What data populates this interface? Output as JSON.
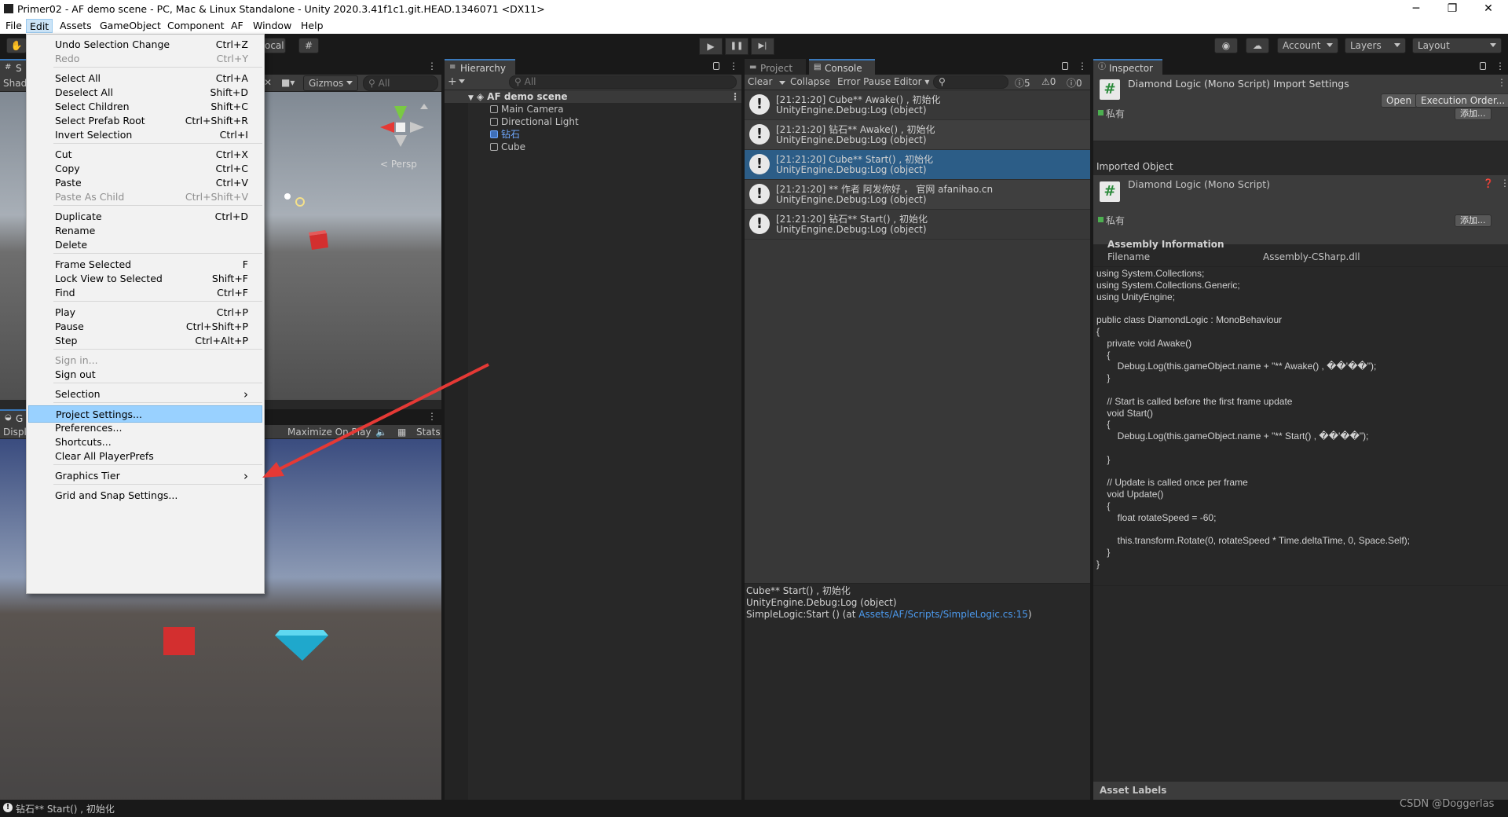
{
  "window": {
    "title": "Primer02 - AF demo scene - PC, Mac & Linux Standalone - Unity 2020.3.41f1c1.git.HEAD.1346071 <DX11>",
    "minimize_glyph": "─",
    "maximize_glyph": "❐",
    "close_glyph": "✕"
  },
  "menubar": [
    "File",
    "Edit",
    "Assets",
    "GameObject",
    "Component",
    "AF",
    "Window",
    "Help"
  ],
  "toolbar": {
    "pivot_partial": "ocal",
    "play_glyph": "▶",
    "pause_glyph": "❚❚",
    "step_glyph": "▶|",
    "account_label": "Account",
    "layers_label": "Layers",
    "layout_label": "Layout"
  },
  "scene_panel": {
    "tab_partial": "S",
    "shading_partial": "Shad",
    "gizmos_label": "Gizmos",
    "search_placeholder": "All",
    "persp_label": "< Persp"
  },
  "game_panel": {
    "tab_partial": "G",
    "display_partial": "Displ",
    "maximize_label": "Maximize On Play",
    "stats_label": "Stats"
  },
  "hierarchy": {
    "tab_label": "Hierarchy",
    "add_label": "+",
    "search_placeholder": "All",
    "scene_name": "AF demo scene",
    "items": [
      "Main Camera",
      "Directional Light",
      "钻石",
      "Cube"
    ]
  },
  "console": {
    "tab_project": "Project",
    "tab_console": "Console",
    "clear_label": "Clear",
    "collapse_label": "Collapse",
    "error_pause_label": "Error Pause",
    "editor_label": "Editor",
    "count_info": "5",
    "count_warn": "0",
    "count_error": "0",
    "entries": [
      {
        "line1": "[21:21:20] Cube** Awake() , 初始化",
        "line2": "UnityEngine.Debug:Log (object)"
      },
      {
        "line1": "[21:21:20] 钻石** Awake() , 初始化",
        "line2": "UnityEngine.Debug:Log (object)"
      },
      {
        "line1": "[21:21:20] Cube** Start() , 初始化",
        "line2": "UnityEngine.Debug:Log (object)"
      },
      {
        "line1": "[21:21:20] ** 作者 阿发你好 ， 官网 afanihao.cn",
        "line2": "UnityEngine.Debug:Log (object)"
      },
      {
        "line1": "[21:21:20] 钻石** Start() , 初始化",
        "line2": "UnityEngine.Debug:Log (object)"
      }
    ],
    "detail": {
      "line1": "Cube** Start() , 初始化",
      "line2": "UnityEngine.Debug:Log (object)",
      "line3_prefix": "SimpleLogic:Start () (at ",
      "line3_link": "Assets/AF/Scripts/SimpleLogic.cs:15",
      "line3_suffix": ")"
    }
  },
  "inspector": {
    "tab_label": "Inspector",
    "import_title": "Diamond Logic (Mono Script) Import Settings",
    "open_label": "Open",
    "execution_order_label": "Execution Order...",
    "private_label": "私有",
    "add_label": "添加...",
    "imported_object_label": "Imported Object",
    "script_title": "Diamond Logic (Mono Script)",
    "assembly_header": "Assembly Information",
    "filename_label": "Filename",
    "filename_value": "Assembly-CSharp.dll",
    "code": [
      "using System.Collections;",
      "using System.Collections.Generic;",
      "using UnityEngine;",
      "",
      "public class DiamondLogic : MonoBehaviour",
      "{",
      "    private void Awake()",
      "    {",
      "        Debug.Log(this.gameObject.name + \"** Awake() , ��'��\");",
      "    }",
      "",
      "    // Start is called before the first frame update",
      "    void Start()",
      "    {",
      "        Debug.Log(this.gameObject.name + \"** Start() , ��'��\");",
      "",
      "    }",
      "",
      "    // Update is called once per frame",
      "    void Update()",
      "    {",
      "        float rotateSpeed = -60;",
      "",
      "        this.transform.Rotate(0, rotateSpeed * Time.deltaTime, 0, Space.Self);",
      "    }",
      "}"
    ],
    "asset_labels": "Asset Labels"
  },
  "edit_menu": {
    "items": [
      {
        "label": "Undo Selection Change",
        "shortcut": "Ctrl+Z",
        "disabled": false
      },
      {
        "label": "Redo",
        "shortcut": "Ctrl+Y",
        "disabled": true
      },
      {
        "sep": true
      },
      {
        "label": "Select All",
        "shortcut": "Ctrl+A",
        "disabled": false
      },
      {
        "label": "Deselect All",
        "shortcut": "Shift+D",
        "disabled": false
      },
      {
        "label": "Select Children",
        "shortcut": "Shift+C",
        "disabled": false
      },
      {
        "label": "Select Prefab Root",
        "shortcut": "Ctrl+Shift+R",
        "disabled": false
      },
      {
        "label": "Invert Selection",
        "shortcut": "Ctrl+I",
        "disabled": false
      },
      {
        "sep": true
      },
      {
        "label": "Cut",
        "shortcut": "Ctrl+X",
        "disabled": false
      },
      {
        "label": "Copy",
        "shortcut": "Ctrl+C",
        "disabled": false
      },
      {
        "label": "Paste",
        "shortcut": "Ctrl+V",
        "disabled": false
      },
      {
        "label": "Paste As Child",
        "shortcut": "Ctrl+Shift+V",
        "disabled": true
      },
      {
        "sep": true
      },
      {
        "label": "Duplicate",
        "shortcut": "Ctrl+D",
        "disabled": false
      },
      {
        "label": "Rename",
        "shortcut": "",
        "disabled": false
      },
      {
        "label": "Delete",
        "shortcut": "",
        "disabled": false
      },
      {
        "sep": true
      },
      {
        "label": "Frame Selected",
        "shortcut": "F",
        "disabled": false
      },
      {
        "label": "Lock View to Selected",
        "shortcut": "Shift+F",
        "disabled": false
      },
      {
        "label": "Find",
        "shortcut": "Ctrl+F",
        "disabled": false
      },
      {
        "sep": true
      },
      {
        "label": "Play",
        "shortcut": "Ctrl+P",
        "disabled": false
      },
      {
        "label": "Pause",
        "shortcut": "Ctrl+Shift+P",
        "disabled": false
      },
      {
        "label": "Step",
        "shortcut": "Ctrl+Alt+P",
        "disabled": false
      },
      {
        "sep": true
      },
      {
        "label": "Sign in...",
        "shortcut": "",
        "disabled": true
      },
      {
        "label": "Sign out",
        "shortcut": "",
        "disabled": false
      },
      {
        "sep": true
      },
      {
        "label": "Selection",
        "shortcut": "›",
        "disabled": false
      },
      {
        "sep": true
      },
      {
        "label": "Project Settings...",
        "shortcut": "",
        "disabled": false,
        "highlighted": true
      },
      {
        "label": "Preferences...",
        "shortcut": "",
        "disabled": false
      },
      {
        "label": "Shortcuts...",
        "shortcut": "",
        "disabled": false
      },
      {
        "label": "Clear All PlayerPrefs",
        "shortcut": "",
        "disabled": false
      },
      {
        "sep": true
      },
      {
        "label": "Graphics Tier",
        "shortcut": "›",
        "disabled": false
      },
      {
        "sep": true
      },
      {
        "label": "Grid and Snap Settings...",
        "shortcut": "",
        "disabled": false
      }
    ]
  },
  "statusbar": {
    "message": "钻石** Start() , 初始化",
    "watermark": "CSDN @Doggerlas"
  },
  "colors": {
    "accent_blue": "#3a79bb",
    "selection_row": "#2c5d87",
    "menu_highlight": "#99d1ff",
    "arrow_red": "#e53935",
    "cube_red": "#d32f2f",
    "diamond_cyan": "#3ec8e6",
    "link_blue": "#4c9bf0"
  }
}
